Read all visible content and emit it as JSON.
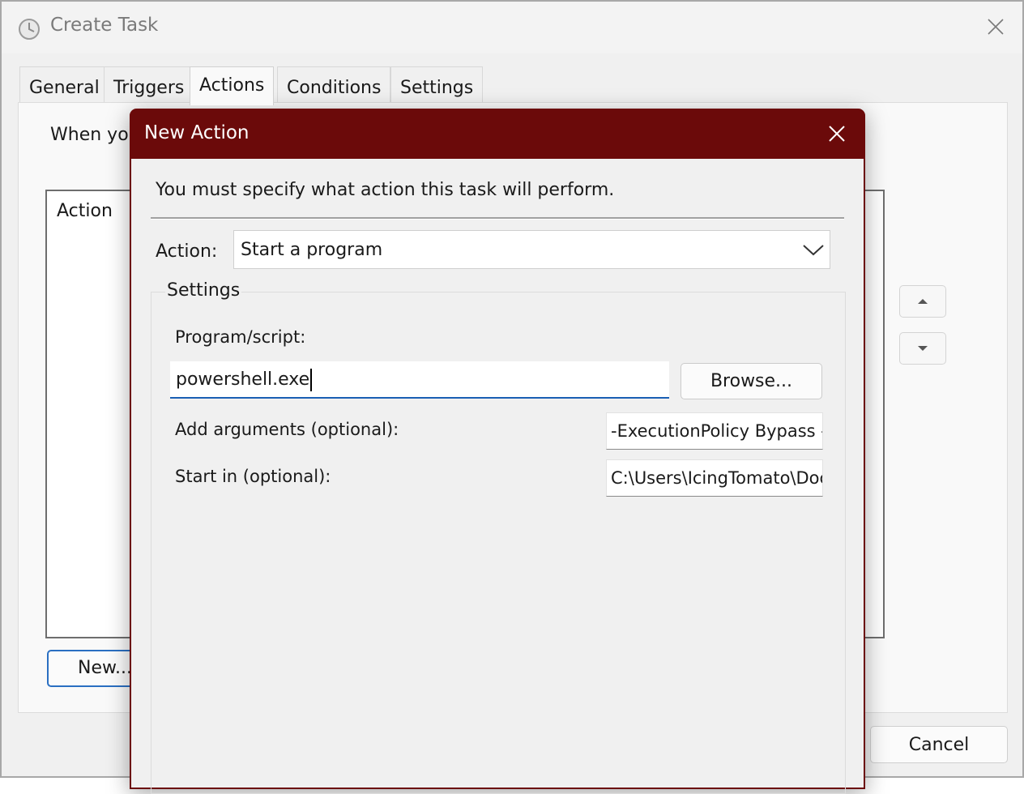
{
  "window": {
    "title": "Create Task",
    "tabs": [
      "General",
      "Triggers",
      "Actions",
      "Conditions",
      "Settings"
    ],
    "active_tab": "Actions",
    "intro_text": "When yo",
    "list_header": "Action",
    "new_button": "New...",
    "cancel_button": "Cancel"
  },
  "dialog": {
    "title": "New Action",
    "instruction": "You must specify what action this task will perform.",
    "action_label": "Action:",
    "action_value": "Start a program",
    "settings_legend": "Settings",
    "program_label": "Program/script:",
    "program_value": "powershell.exe",
    "browse_button": "Browse...",
    "args_label": "Add arguments (optional):",
    "args_value": "-ExecutionPolicy Bypass -",
    "startin_label": "Start in (optional):",
    "startin_value": "C:\\Users\\IcingTomato\\Doc"
  },
  "colors": {
    "dialog_titlebar": "#6b0a0a",
    "focus_accent": "#1a5fb4"
  },
  "icons": {
    "title": "clock-icon",
    "close": "close-icon",
    "move_up": "move-up-arrow-icon",
    "move_down": "move-down-arrow-icon",
    "dropdown": "chevron-down-icon"
  }
}
